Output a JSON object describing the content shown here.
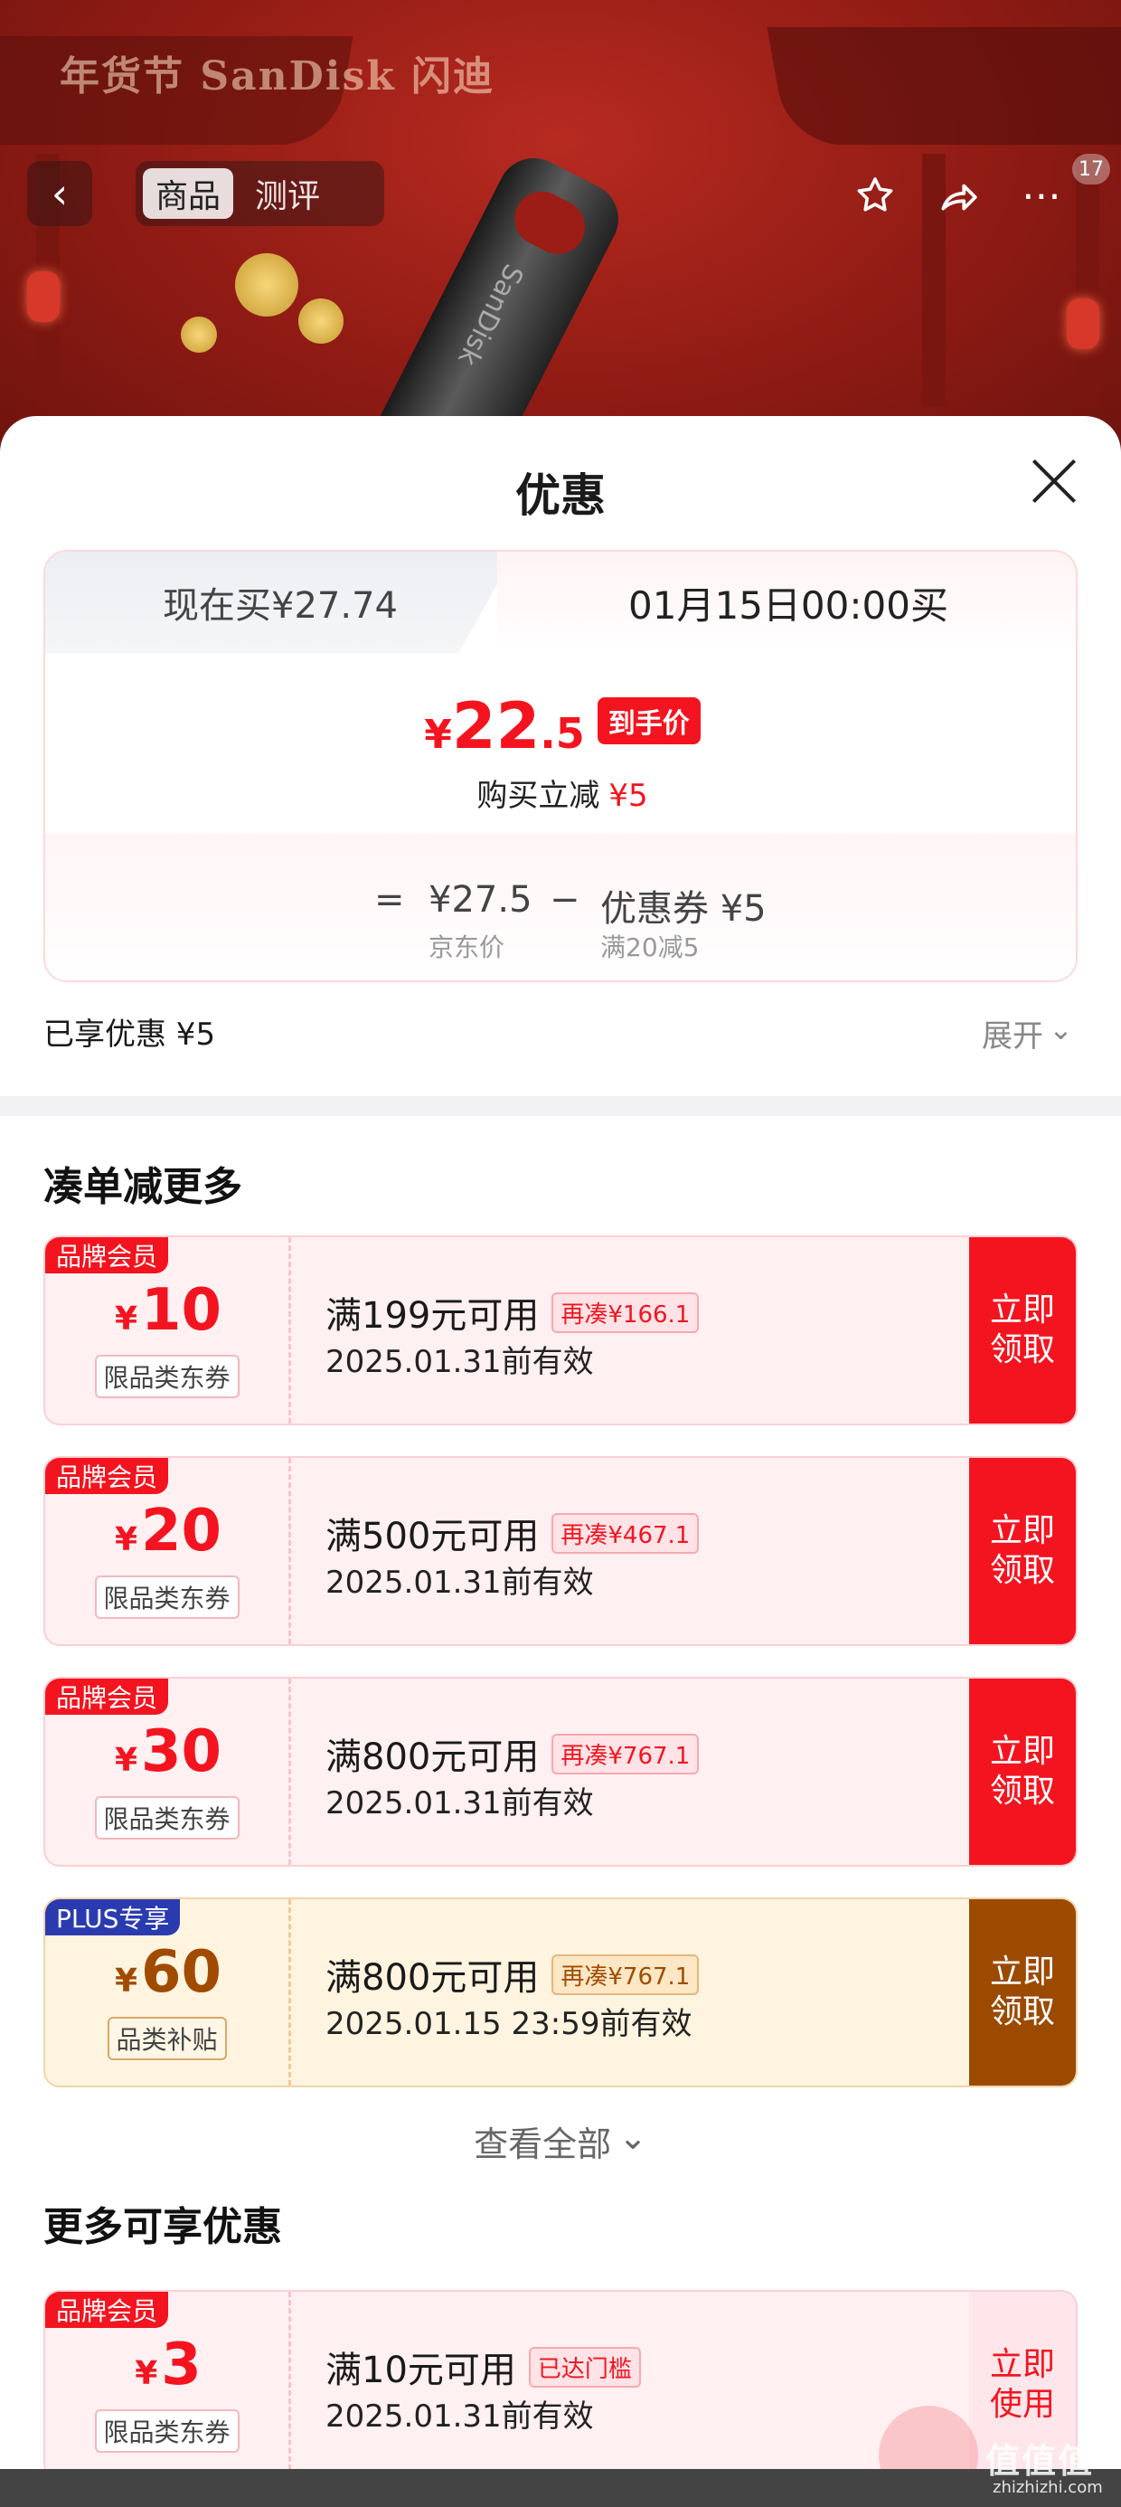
{
  "banner": {
    "brand_text": "年货节 SanDisk 闪迪",
    "usb_text": "SanDisk",
    "tabs": [
      "商品",
      "测评"
    ],
    "badge_count": "17"
  },
  "sheet": {
    "title": "优惠",
    "price_card": {
      "tab_now": "现在买¥27.74",
      "tab_future": "01月15日00:00买",
      "yen": "¥",
      "price_int": "22",
      "price_dec": ".5",
      "price_tag": "到手价",
      "instant_cut_label": "购买立减",
      "instant_cut_value": "¥5",
      "eq": "=",
      "jd_price": "¥27.5",
      "jd_price_label": "京东价",
      "minus": "−",
      "coupon_label": "优惠券 ¥5",
      "coupon_sub": "满20减5"
    },
    "enjoyed": "已享优惠 ¥5",
    "expand": "展开",
    "section_more": "凑单减更多",
    "coupons": [
      {
        "badge": "品牌会员",
        "yen": "¥",
        "amount": "10",
        "kind": "限品类东券",
        "cond": "满199元可用",
        "tag": "再凑¥166.1",
        "date": "2025.01.31前有效",
        "btn": "立即\n领取"
      },
      {
        "badge": "品牌会员",
        "yen": "¥",
        "amount": "20",
        "kind": "限品类东券",
        "cond": "满500元可用",
        "tag": "再凑¥467.1",
        "date": "2025.01.31前有效",
        "btn": "立即\n领取"
      },
      {
        "badge": "品牌会员",
        "yen": "¥",
        "amount": "30",
        "kind": "限品类东券",
        "cond": "满800元可用",
        "tag": "再凑¥767.1",
        "date": "2025.01.31前有效",
        "btn": "立即\n领取"
      },
      {
        "badge": "PLUS专享",
        "yen": "¥",
        "amount": "60",
        "kind": "品类补贴",
        "cond": "满800元可用",
        "tag": "再凑¥767.1",
        "date": "2025.01.15 23:59前有效",
        "btn": "立即\n领取"
      }
    ],
    "view_all": "查看全部",
    "section_enjoy": "更多可享优惠",
    "enjoy_coupon": {
      "badge": "品牌会员",
      "yen": "¥",
      "amount": "3",
      "kind": "限品类东券",
      "cond": "满10元可用",
      "tag": "已达门槛",
      "date": "2025.01.31前有效",
      "btn": "立即\n使用"
    }
  },
  "watermark": {
    "main": "值值值",
    "sub": "zhizhizhi.com"
  },
  "colors": {
    "accent_red": "#f3141f",
    "plus_brown": "#9b4a00",
    "plus_blue": "#2a3bb0"
  }
}
